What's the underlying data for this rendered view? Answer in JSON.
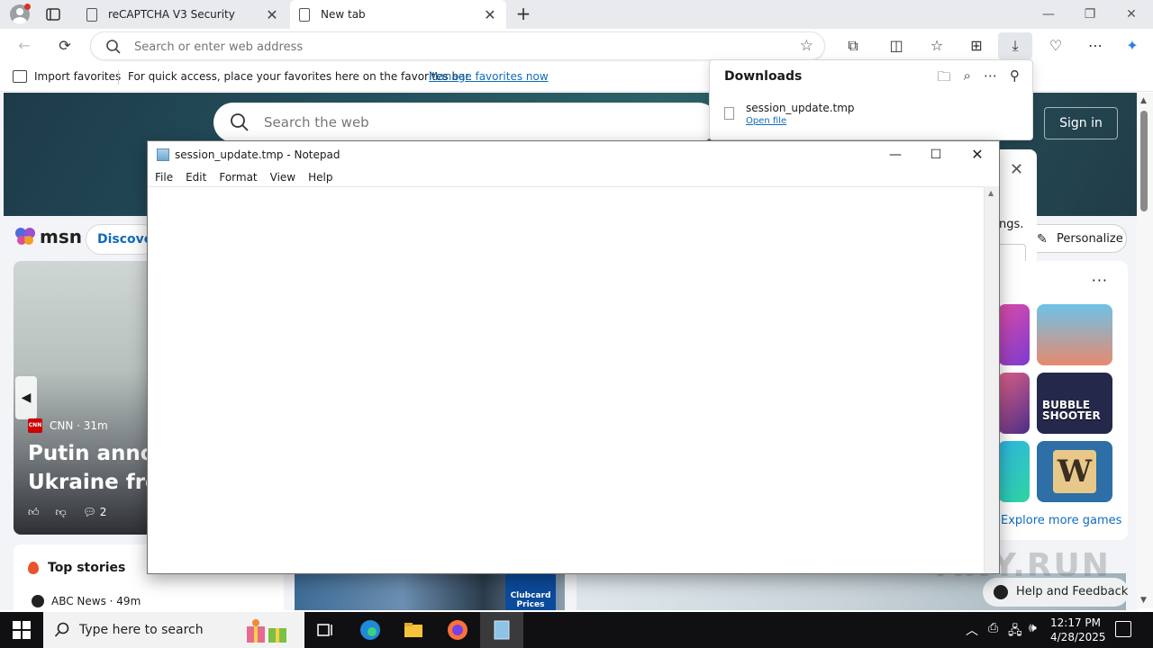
{
  "browser": {
    "tabs": [
      {
        "title": "reCAPTCHA V3 Security",
        "close": "✕"
      },
      {
        "title": "New tab",
        "close": "✕"
      }
    ],
    "new_tab": "+",
    "window_controls": {
      "minimize": "—",
      "restore": "❐",
      "close": "✕"
    },
    "address_placeholder": "Search or enter web address",
    "favorites_bar": {
      "import_label": "Import favorites",
      "message": "For quick access, place your favorites here on the favorites bar.",
      "manage_link": "Manage favorites now"
    }
  },
  "downloads": {
    "title": "Downloads",
    "file_name": "session_update.tmp",
    "open_label": "Open file"
  },
  "msn": {
    "search_placeholder": "Search the web",
    "sign_in": "Sign in",
    "logo_text": "msn",
    "discover": "Discover",
    "personalize": "Personalize",
    "notif_fragment": "ngs.",
    "story": {
      "source": "CNN · 31m",
      "headline": "Putin announces Ukraine fron",
      "comments": "2"
    },
    "top_stories": {
      "title": "Top stories",
      "source": "ABC News · 49m"
    },
    "clubcard": "Clubcard Prices",
    "games": {
      "more": "···",
      "bubble": "BUBBLE SHOOTER",
      "scrabble_tile": "W",
      "explore": "Explore more games"
    },
    "help": "Help and Feedback",
    "watermark": "ANY.RUN"
  },
  "notepad": {
    "title": "session_update.tmp - Notepad",
    "menu": [
      "File",
      "Edit",
      "Format",
      "View",
      "Help"
    ],
    "content": ""
  },
  "taskbar": {
    "search_placeholder": "Type here to search",
    "time": "12:17 PM",
    "date": "4/28/2025"
  }
}
